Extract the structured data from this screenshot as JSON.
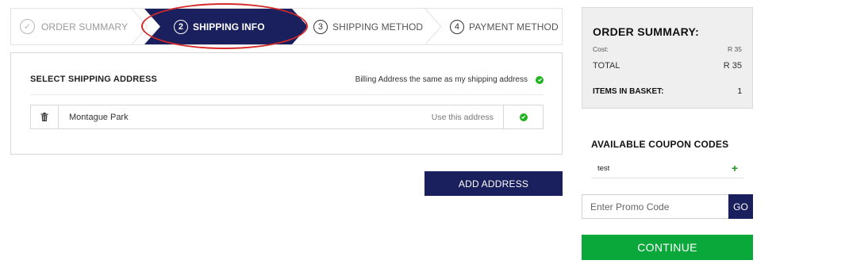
{
  "steps": [
    {
      "label": "ORDER SUMMARY",
      "state": "complete",
      "icon": "check-circle-icon"
    },
    {
      "number": "2",
      "label": "SHIPPING INFO",
      "state": "active"
    },
    {
      "number": "3",
      "label": "SHIPPING METHOD",
      "state": "pending"
    },
    {
      "number": "4",
      "label": "PAYMENT METHOD",
      "state": "pending"
    }
  ],
  "shipping": {
    "heading": "SELECT SHIPPING ADDRESS",
    "billing_same_label": "Billing Address the same as my shipping address",
    "addresses": [
      {
        "name": "Montague Park",
        "use_label": "Use this address"
      }
    ],
    "add_address_label": "ADD ADDRESS"
  },
  "summary": {
    "title": "ORDER SUMMARY:",
    "cost_label": "Cost:",
    "cost_value": "R 35",
    "total_label": "TOTAL",
    "total_value": "R 35",
    "items_label": "ITEMS IN BASKET:",
    "items_value": "1"
  },
  "coupons": {
    "title": "AVAILABLE COUPON CODES",
    "items": [
      {
        "code": "test",
        "add_icon": "plus-icon"
      }
    ]
  },
  "promo": {
    "placeholder": "Enter Promo Code",
    "go_label": "GO"
  },
  "continue_label": "CONTINUE",
  "colors": {
    "navy": "#1a1f5e",
    "green": "#0aa83a",
    "check_green": "#1db41d",
    "highlight_red": "#d42a2a"
  }
}
